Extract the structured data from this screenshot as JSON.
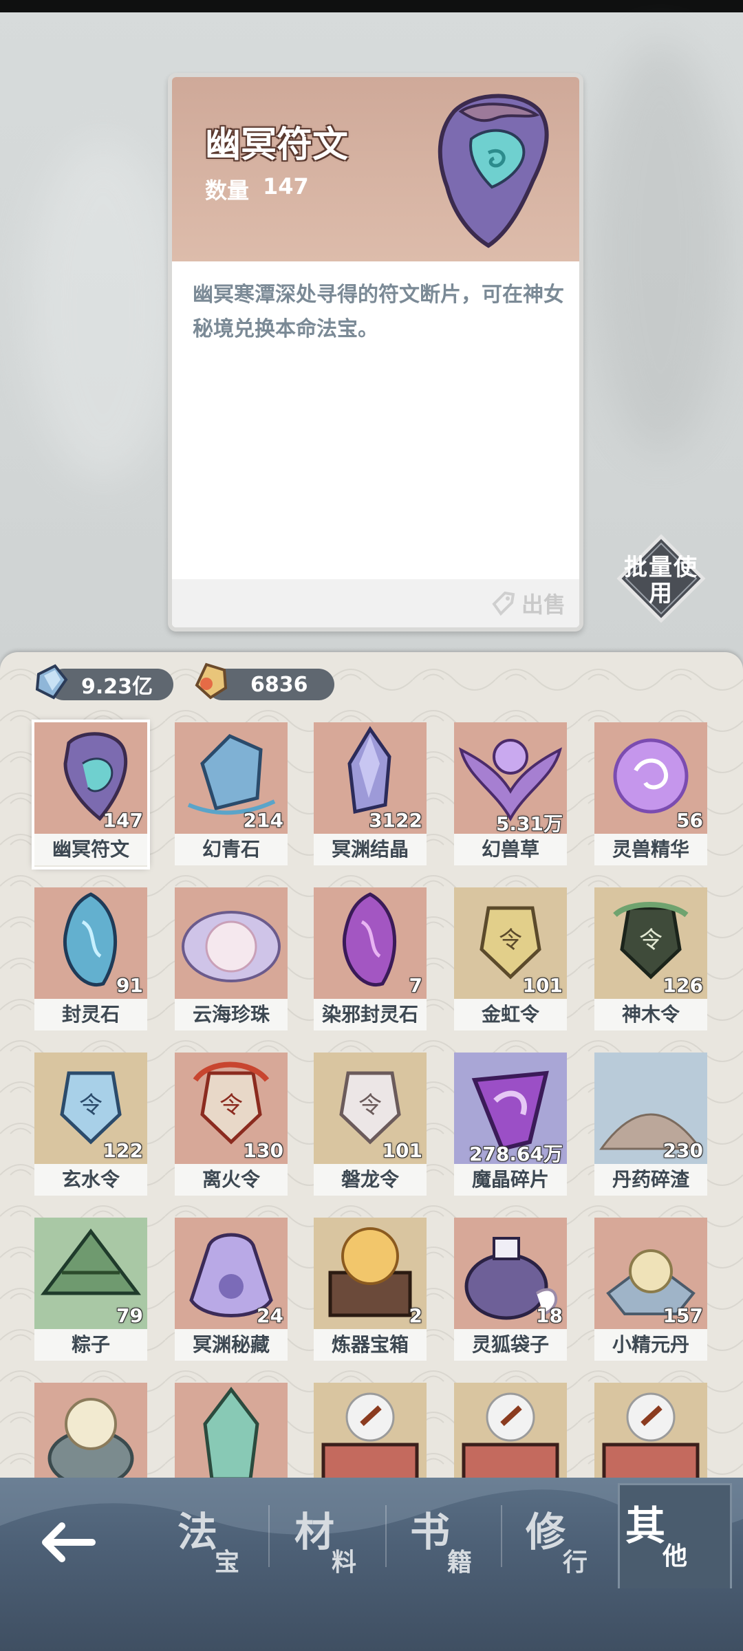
{
  "detail": {
    "title": "幽冥符文",
    "quantity_label": "数量",
    "quantity_value": "147",
    "description": "幽冥寒潭深处寻得的符文断片，可在神女秘境兑换本命法宝。",
    "sell_label": "出售",
    "batch_use_label": "批量使用"
  },
  "currency": [
    {
      "name": "spirit-stone",
      "value": "9.23亿"
    },
    {
      "name": "gold-crystal",
      "value": "6836"
    }
  ],
  "items": [
    {
      "name": "幽冥符文",
      "qty": "147",
      "bg": "#d7a898",
      "selected": true,
      "icon": "rune-icon"
    },
    {
      "name": "幻青石",
      "qty": "214",
      "bg": "#d7a898",
      "icon": "blue-stone-icon"
    },
    {
      "name": "冥渊结晶",
      "qty": "3122",
      "bg": "#d7a898",
      "icon": "crystal-icon"
    },
    {
      "name": "幻兽草",
      "qty": "5.31万",
      "bg": "#d7a898",
      "icon": "herb-icon"
    },
    {
      "name": "灵兽精华",
      "qty": "56",
      "bg": "#d7a898",
      "icon": "essence-orb-icon"
    },
    {
      "name": "封灵石",
      "qty": "91",
      "bg": "#d7a898",
      "icon": "seal-stone-icon"
    },
    {
      "name": "云海珍珠",
      "qty": "",
      "bg": "#d7a898",
      "icon": "pearl-icon"
    },
    {
      "name": "染邪封灵石",
      "qty": "7",
      "bg": "#d7a898",
      "icon": "purple-seal-stone-icon"
    },
    {
      "name": "金虹令",
      "qty": "101",
      "bg": "#d9c5a0",
      "icon": "gold-token-icon"
    },
    {
      "name": "神木令",
      "qty": "126",
      "bg": "#d9c5a0",
      "icon": "wood-token-icon"
    },
    {
      "name": "玄水令",
      "qty": "122",
      "bg": "#d9c5a0",
      "icon": "water-token-icon"
    },
    {
      "name": "离火令",
      "qty": "130",
      "bg": "#d7a898",
      "icon": "fire-token-icon"
    },
    {
      "name": "磐龙令",
      "qty": "101",
      "bg": "#d9c5a0",
      "icon": "dragon-token-icon"
    },
    {
      "name": "魔晶碎片",
      "qty": "278.64万",
      "bg": "#a9a6d6",
      "icon": "magic-crystal-shard-icon"
    },
    {
      "name": "丹药碎渣",
      "qty": "230",
      "bg": "#b9cbd9",
      "icon": "pill-residue-icon"
    },
    {
      "name": "粽子",
      "qty": "79",
      "bg": "#a9c8a5",
      "icon": "zongzi-icon"
    },
    {
      "name": "冥渊秘藏",
      "qty": "24",
      "bg": "#d7a898",
      "icon": "treasure-bag-icon"
    },
    {
      "name": "炼器宝箱",
      "qty": "2",
      "bg": "#d9c5a0",
      "icon": "forge-chest-icon"
    },
    {
      "name": "灵狐袋子",
      "qty": "18",
      "bg": "#d7a898",
      "icon": "fox-bag-icon"
    },
    {
      "name": "小精元丹",
      "qty": "157",
      "bg": "#d7a898",
      "icon": "elixir-icon"
    },
    {
      "name": "",
      "qty": "",
      "bg": "#d7a898",
      "icon": "jar-icon"
    },
    {
      "name": "",
      "qty": "",
      "bg": "#d7a898",
      "icon": "artifact-icon"
    },
    {
      "name": "",
      "qty": "",
      "bg": "#d9c5a0",
      "icon": "box-icon"
    },
    {
      "name": "",
      "qty": "",
      "bg": "#d9c5a0",
      "icon": "box-icon"
    },
    {
      "name": "",
      "qty": "",
      "bg": "#d9c5a0",
      "icon": "box-icon"
    }
  ],
  "tabs": [
    {
      "big": "法",
      "small": "宝"
    },
    {
      "big": "材",
      "small": "料"
    },
    {
      "big": "书",
      "small": "籍"
    },
    {
      "big": "修",
      "small": "行"
    },
    {
      "big": "其",
      "small": "他",
      "active": true
    }
  ]
}
